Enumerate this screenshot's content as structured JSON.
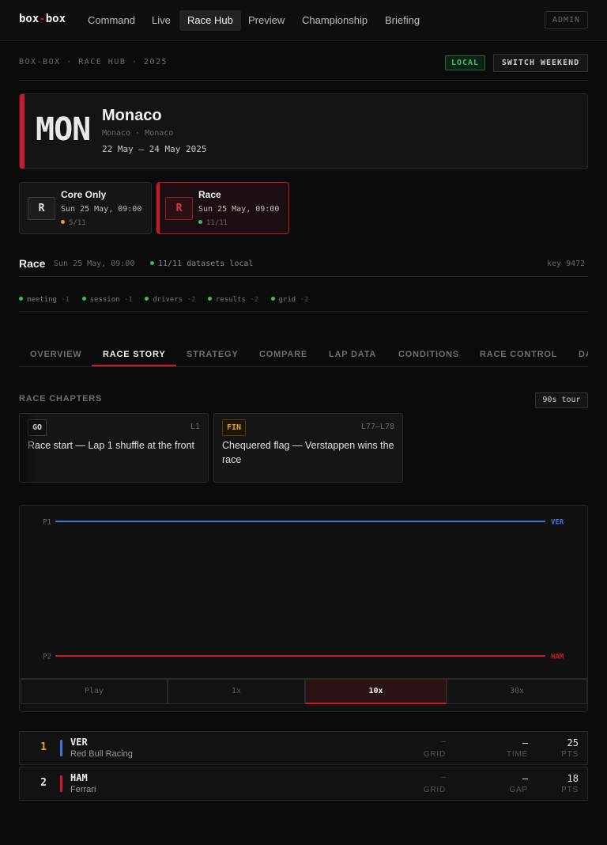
{
  "nav": {
    "logo_box": "box",
    "logo_dash": "-",
    "logo_box2": "box",
    "items": [
      "Command",
      "Live",
      "Race Hub",
      "Preview",
      "Championship",
      "Briefing"
    ],
    "active": "Race Hub",
    "admin_label": "ADMIN"
  },
  "header": {
    "breadcrumb": "BOX-BOX · RACE HUB · 2025",
    "local_badge": "LOCAL",
    "switch_label": "SWITCH WEEKEND"
  },
  "event": {
    "code": "MON",
    "name": "Monaco",
    "location": "Monaco · Monaco",
    "dates": "22 May – 24 May 2025"
  },
  "sessions": [
    {
      "icon": "R",
      "name": "Core Only",
      "time": "Sun 25 May, 09:00",
      "count": "5/11",
      "status_color": "#e6a21b",
      "active": false
    },
    {
      "icon": "R",
      "name": "Race",
      "time": "Sun 25 May, 09:00",
      "count": "11/11",
      "status_color": "#2fbf6a",
      "active": true
    }
  ],
  "session_header": {
    "title": "Race",
    "time": "Sun 25 May, 09:00",
    "datasets": "11/11 datasets local",
    "key": "key 9472"
  },
  "datasets": [
    {
      "name": "meeting",
      "count": "·1"
    },
    {
      "name": "session",
      "count": "·1"
    },
    {
      "name": "drivers",
      "count": "·2"
    },
    {
      "name": "results",
      "count": "·2"
    },
    {
      "name": "grid",
      "count": "·2"
    }
  ],
  "tabs": [
    "OVERVIEW",
    "RACE STORY",
    "STRATEGY",
    "COMPARE",
    "LAP DATA",
    "CONDITIONS",
    "RACE CONTROL",
    "DA"
  ],
  "active_tab": "RACE STORY",
  "chapters_section": {
    "label": "RACE CHAPTERS",
    "tour_label": "90s tour"
  },
  "chapters": [
    {
      "badge": "GO",
      "lap": "L1",
      "text": "Race start — Lap 1 shuffle at the front"
    },
    {
      "badge": "FIN",
      "lap": "L77–L78",
      "text": "Chequered flag — Verstappen wins the race"
    }
  ],
  "chart_data": {
    "type": "line",
    "y_ticks": [
      "P1",
      "P2"
    ],
    "series": [
      {
        "name": "VER",
        "color": "#3b78d6",
        "position": 1
      },
      {
        "name": "HAM",
        "color": "#d0162f",
        "position": 2
      }
    ]
  },
  "playback": {
    "buttons": [
      "Play",
      "1x",
      "10x",
      "30x"
    ],
    "active": "10x"
  },
  "results": [
    {
      "pos": "1",
      "code": "VER",
      "team": "Red Bull Racing",
      "team_color": "#3b78d6",
      "grid": "–",
      "grid_label": "GRID",
      "time": "—",
      "time_label": "TIME",
      "pts": "25",
      "pts_label": "PTS"
    },
    {
      "pos": "2",
      "code": "HAM",
      "team": "Ferrari",
      "team_color": "#d0162f",
      "grid": "–",
      "grid_label": "GRID",
      "time": "—",
      "time_label": "GAP",
      "pts": "18",
      "pts_label": "PTS"
    }
  ]
}
